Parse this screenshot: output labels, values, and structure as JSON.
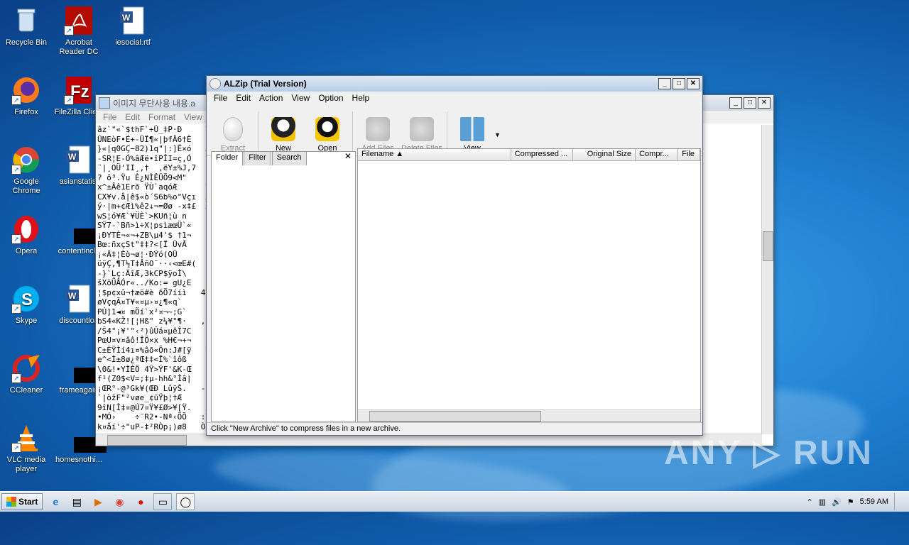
{
  "desktop": {
    "icons": [
      {
        "label": "Recycle Bin",
        "icon": "recycle-bin-icon"
      },
      {
        "label": "Acrobat Reader DC",
        "icon": "acrobat-icon"
      },
      {
        "label": "iesocial.rtf",
        "icon": "word-doc-icon"
      },
      {
        "label": "Firefox",
        "icon": "firefox-icon"
      },
      {
        "label": "FileZilla Client",
        "icon": "filezilla-icon"
      },
      {
        "label": "Google Chrome",
        "icon": "chrome-icon"
      },
      {
        "label": "asianstatist",
        "icon": "word-doc-icon"
      },
      {
        "label": "Opera",
        "icon": "opera-icon"
      },
      {
        "label": "contentinclu",
        "icon": "black-file-icon"
      },
      {
        "label": "Skype",
        "icon": "skype-icon"
      },
      {
        "label": "discountloa",
        "icon": "word-doc-icon"
      },
      {
        "label": "CCleaner",
        "icon": "ccleaner-icon"
      },
      {
        "label": "frameagain",
        "icon": "black-file-icon"
      },
      {
        "label": "VLC media player",
        "icon": "vlc-icon"
      },
      {
        "label": "homesnothi...",
        "icon": "word-doc-icon"
      }
    ]
  },
  "notepad": {
    "title": "이미지 무단사용 내용.a",
    "menu": [
      "File",
      "Edit",
      "Format",
      "View",
      "He"
    ],
    "lines": [
      "âz`\"«`$thF`÷Û_‡P·Ð     ŸÀ   ¾ªµÓ'",
      "ÛNEòF•É+-ÜÏ¶«|þfÂ6†È    N¥0],]¦ªâ,",
      "}«|q0GÇ−82)1q\"|:]É×ó   ÂsHõm\"ÂÄû¬",
      "-SR¦E-Ó%âÆë•îPÎI=ç,Ó   :ês²ê7¨ûO",
      "¨|¸OÜ'II¸,†  ,ëY±%J‚7   ‡9¨¤½ªMÉv`š",
      "? ô³.Ÿu È¿NÌÊÛÕ9<M\"    nÇÿ'À\\ÎÑê©",
      "x^±Âê1Erõ ŸÙ`aqóÆ      ¥'£¬ñÿòI¾ªÏ",
      "CX¥v.å|ê$«ò´S6b%o\"Vçı  Ä¬·nÜìÒì‡1",
      "ý·|m+¢Æì%ê2↓¬=Øø -x‡£  ØVCB'WPP$¬",
      "wS¦ó¥Æ`¥ÜÈ`>KUñ¦ù n    Cl?Œ:Çxw5ç",
      "SŸ7-`Bñ>ì÷X¦psìæœÜ`«   \"ô¬¬=ëš`%›ö",
      "¡ÐYTÈ¬«¬+ZB\\µ4'$ †1¬   ‹ý'ýfp¹D%¬",
      "Bœ:ñxçSt\"‡‡?<[Ï ÛvÂ    ébš¸«¤µÓŸ@",
      "¡«Â‡¦Èò¬ø¦·ÐÝó(OÜ      é/+«Ùl³¶'K¼",
      "üÿÇ,¶T½T‡ÂñO¨··‹<œE#(  é,-H\\ŽŸmì%",
      "-}`Ļç:ÄîÆ,3kCP$ÿoÌ\\    \"%NÕÑõS•J",
      "šXõÜÂÓr«../Ko:= gU¿E   þ5Iuî¨¦ž|ë",
      "¦$p¢xû¬†æö#è ðÖ7ííì   4FÕ]^Sf'½Zœ",
      "øVçqÃ¤T¥«¤µ›¤¿¶«q`     3IbS ¤•9%Ñ,",
      "PÚ]1◄¤ mÖí`x²¤¬~;G`    eP¢bœ\"`5ps",
      "bS4«KŽ![¦Hß\" z¼¥\"¶·   ,x)#|ªZ&îr",
      "/Š4\"¡¥'\"‹²)ûÛá¤µêÎ7C   Pw»ÊÄ%Ÿx§c",
      "PœU¤v¤âô!ÎÖ×x %H€¬+¬   ‹Kâjp9LG¦ã",
      "C±ÈŸÌí4ı¤%âõ«Õn:J#[ÿ   Ÿœ°èx³Ê±n·",
      "e^<Ì±8ø¿ªŒ‡‡<Î%`îôß    'áîSf,¤`r¤",
      "\\0&!•YÌÈÖ 4Ÿ>ÝF'&K-Œ   ƒ²‚L\";¡¬1-¦",
      "f¹(Z0$<V=;‡µ-hh&°Ìâ|   Ë-|R¤BGö%#",
      "¡ŒR°-@³Gk¥(ŒÐ LûÿŠ.   -ê]m`Â0-ÿ½@",
      "`|òžF\"²vøe_¢üŸþ¦†Æ     Î|¤>0w€ ê£",
      "9îN[Ì‡¤@Ú7¤Ÿ¥£Ø>¥[Ÿ.   ,0±¡›]ÂôDU",
      "•MÓ›    ÷¨R2•-Nª‹ÖÕ   :ŸÕñÍ:_{ö5",
      "k¤åí'÷\"uP-‡²RÒp¡)ø8   ÒF\\aG|_³TÂ("
    ]
  },
  "alzip": {
    "title": "ALZip (Trial Version)",
    "menu": [
      "File",
      "Edit",
      "Action",
      "View",
      "Option",
      "Help"
    ],
    "toolbar": {
      "extract": "Extract",
      "new": "New",
      "open": "Open",
      "add_files": "Add Files",
      "delete_files": "Delete Files",
      "view": "View"
    },
    "tabs": [
      "Folder",
      "Filter",
      "Search"
    ],
    "columns": [
      "Filename",
      "Compressed ...",
      "Original Size",
      "Compr...",
      "File"
    ],
    "status": "Click \"New Archive\" to compress files in a new archive."
  },
  "taskbar": {
    "start_label": "Start",
    "clock": "5:59 AM"
  },
  "watermark": "ANY ▷ RUN"
}
